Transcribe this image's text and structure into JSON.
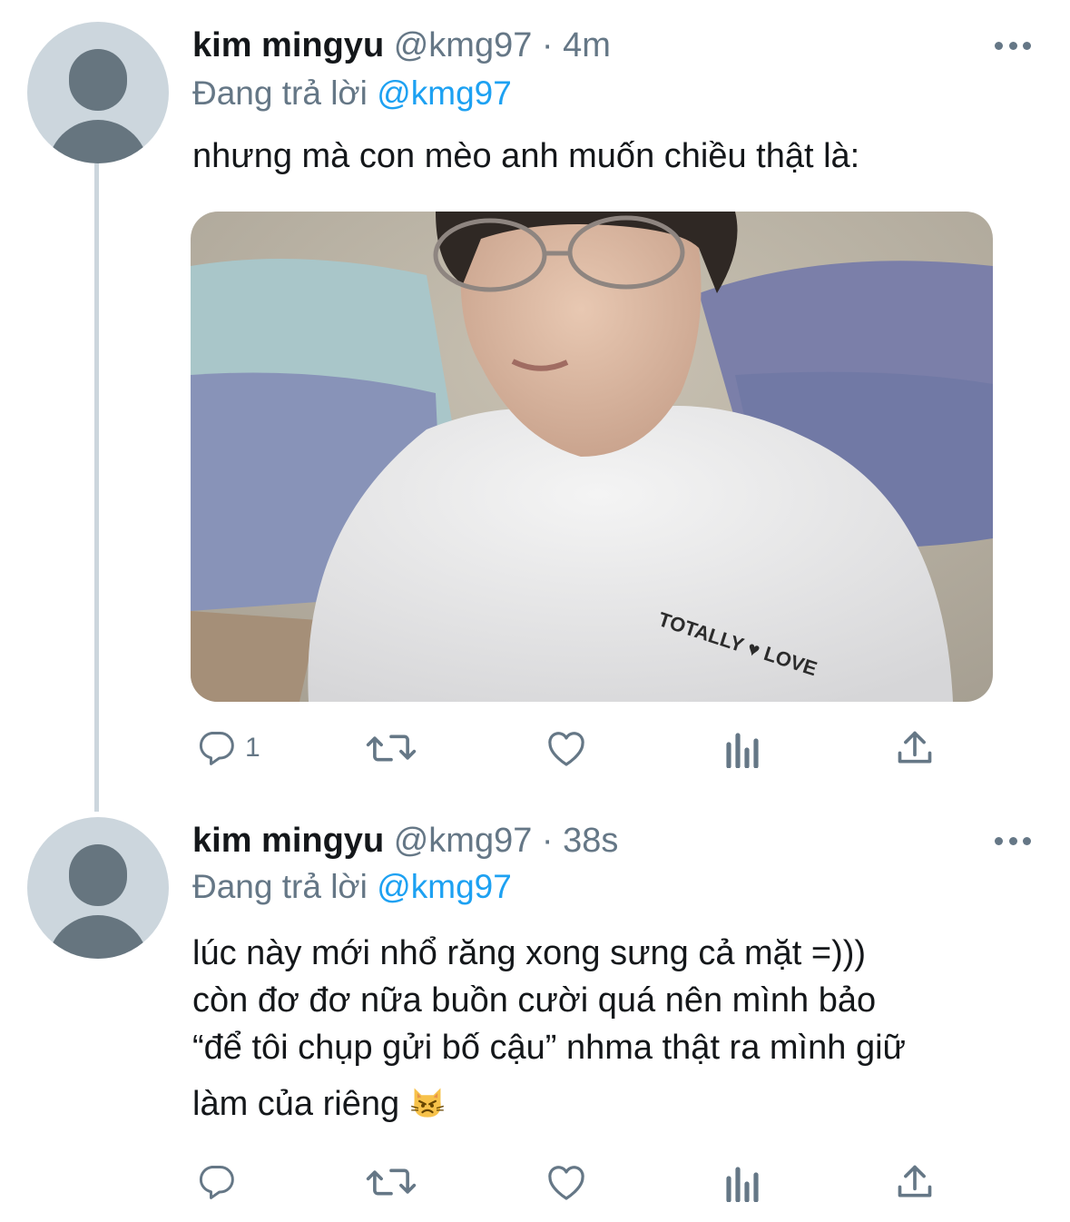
{
  "tweets": [
    {
      "name": "kim mingyu",
      "handle": "@kmg97",
      "dot": "·",
      "time": "4m",
      "reply_prefix": "Đang trả lời",
      "reply_mention": "@kmg97",
      "text": "nhưng mà con mèo anh muốn chiều thật là:",
      "has_media": true,
      "reply_count": "1"
    },
    {
      "name": "kim mingyu",
      "handle": "@kmg97",
      "dot": "·",
      "time": "38s",
      "reply_prefix": "Đang trả lời",
      "reply_mention": "@kmg97",
      "text_lines": [
        "lúc này mới nhổ răng xong sưng cả mặt =)))",
        "còn đơ đơ nữa buồn cười quá nên mình bảo",
        "“để tôi chụp gửi bố cậu” nhma thật ra mình giữ",
        "làm của riêng"
      ],
      "has_media": false,
      "reply_count": ""
    }
  ],
  "icons": {
    "more": "more-horizontal-icon",
    "reply": "reply-icon",
    "retweet": "retweet-icon",
    "like": "heart-icon",
    "analytics": "analytics-icon",
    "share": "share-icon",
    "emoji": "pouting-cat-emoji"
  },
  "colors": {
    "text": "#14171a",
    "secondary": "#657786",
    "link": "#1da1f2",
    "thread_line": "#ccd6dd"
  }
}
